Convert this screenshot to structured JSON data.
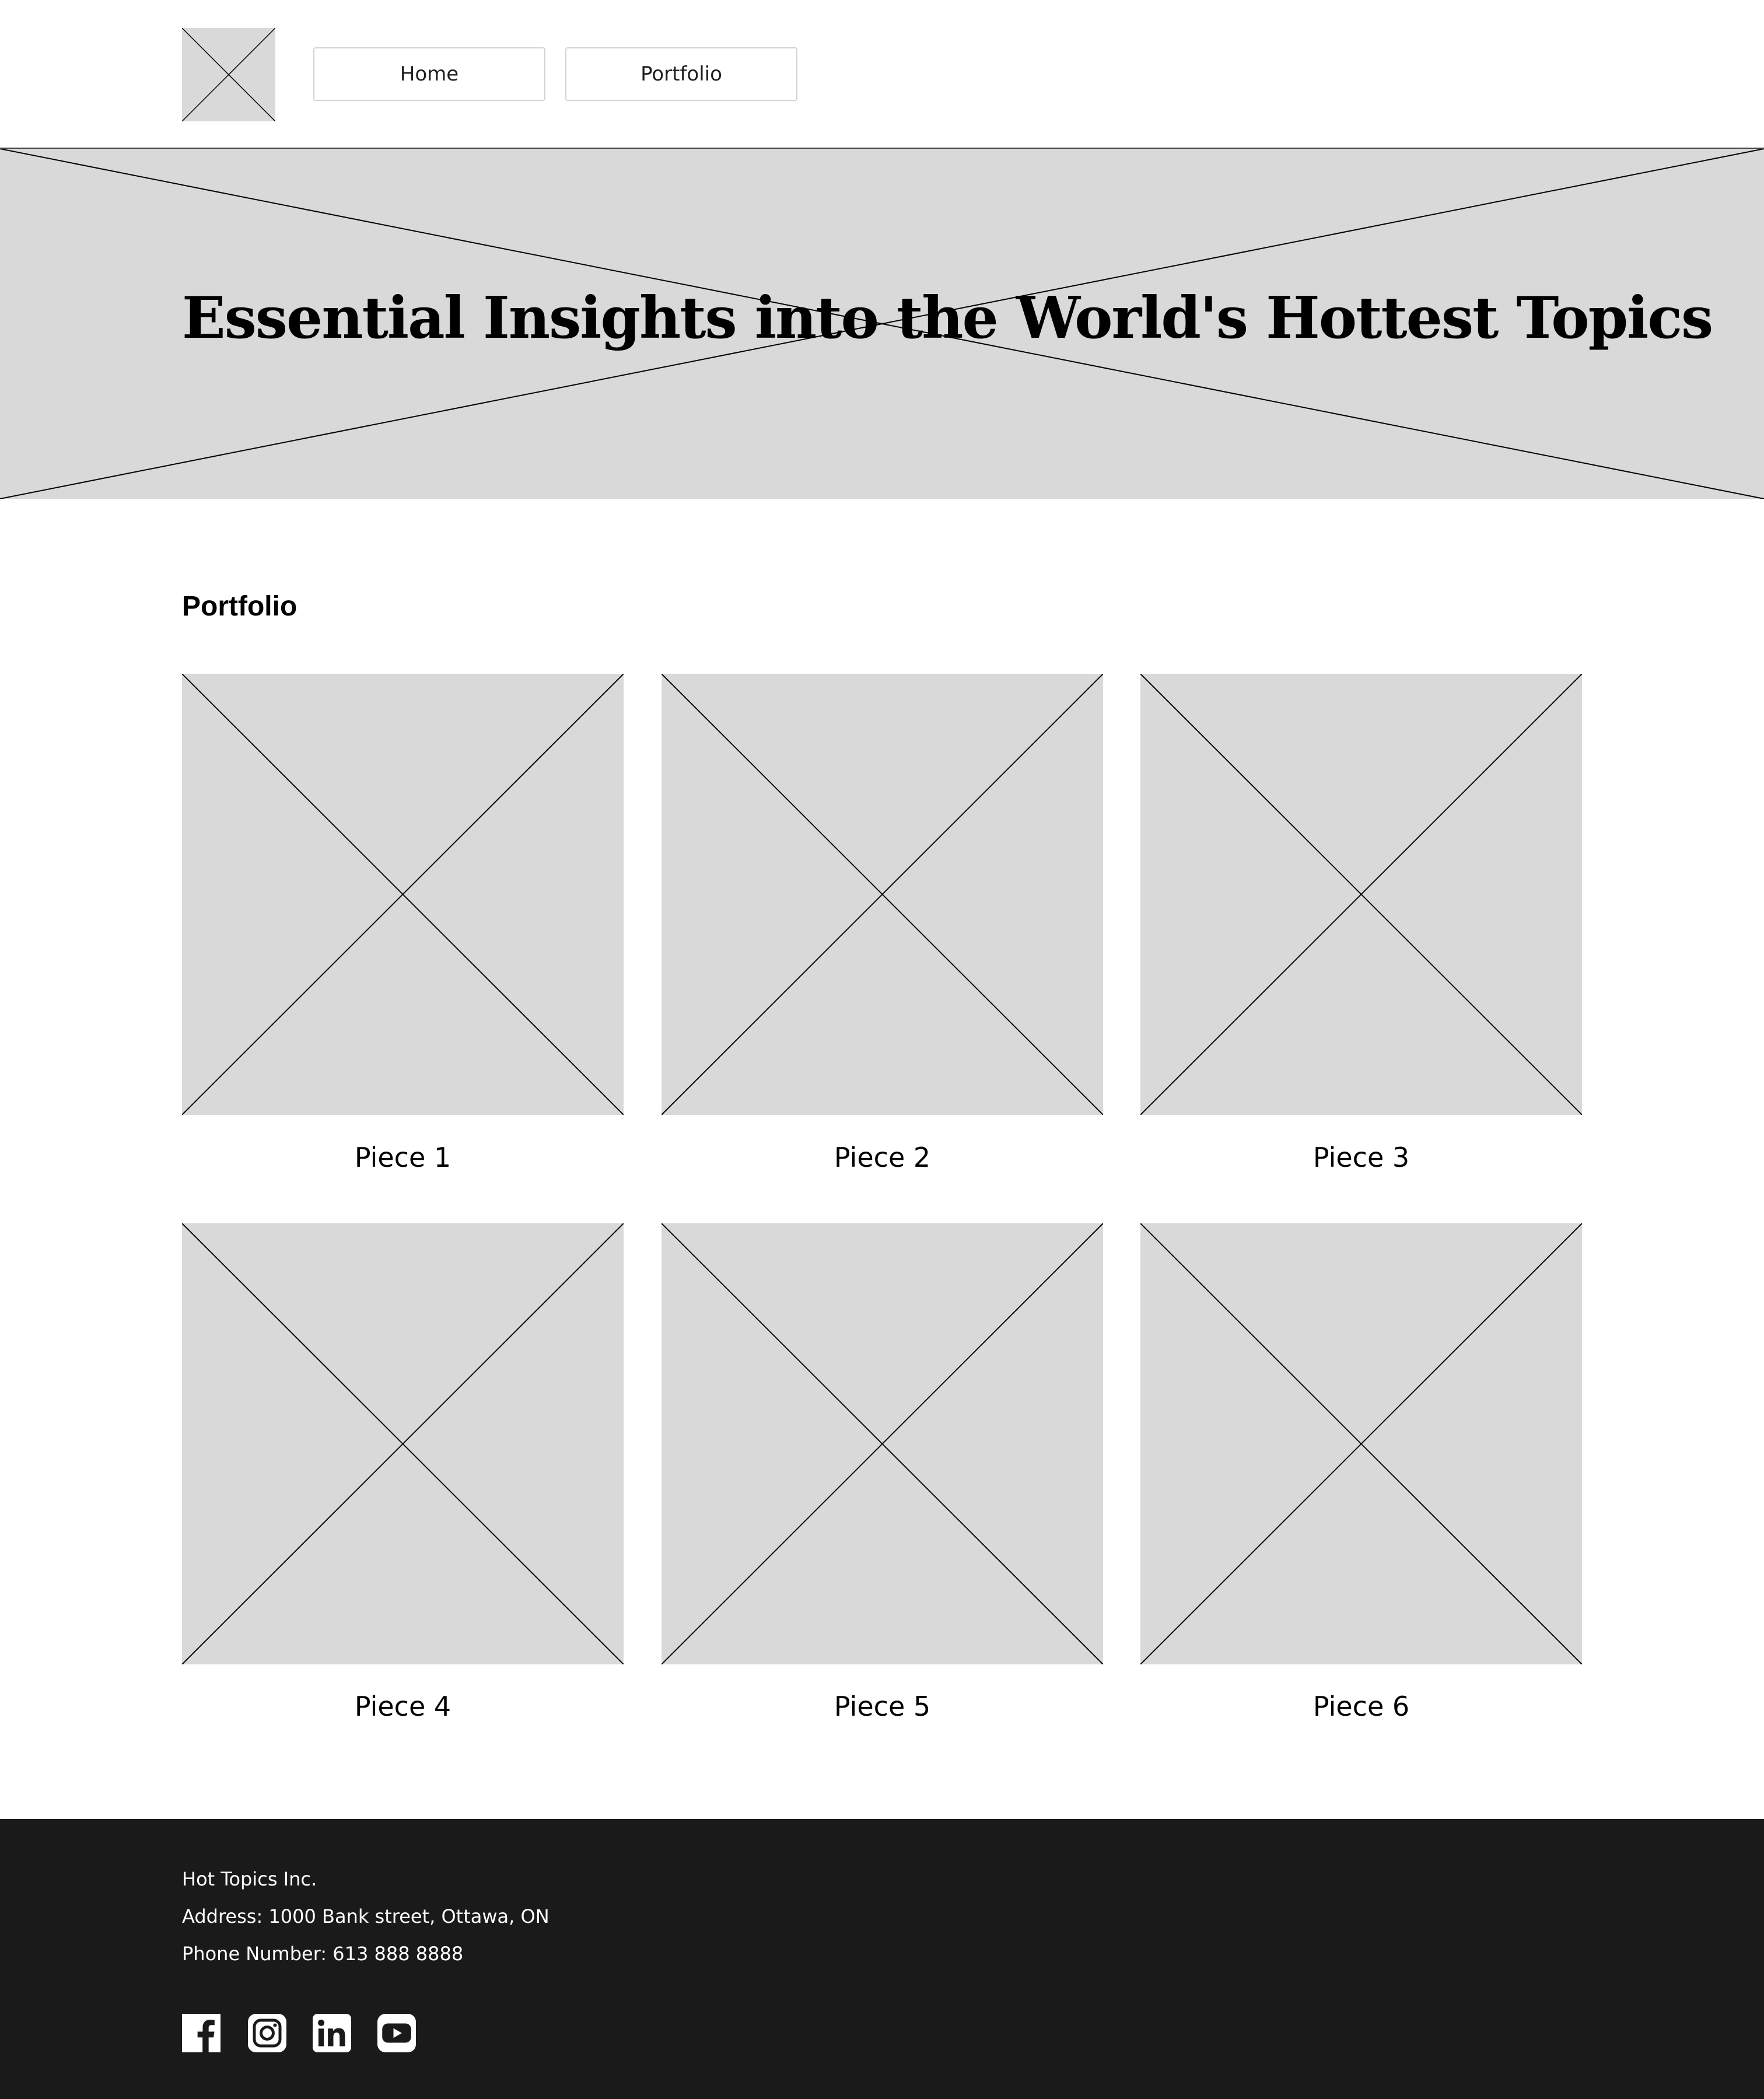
{
  "header": {
    "logo_icon": "image-placeholder-icon",
    "nav": [
      {
        "label": "Home"
      },
      {
        "label": "Portfolio"
      }
    ]
  },
  "hero": {
    "title": "Essential Insights into the World's Hottest Topics",
    "background_icon": "image-placeholder-icon"
  },
  "portfolio": {
    "heading": "Portfolio",
    "items": [
      {
        "caption": "Piece 1",
        "image_icon": "image-placeholder-icon"
      },
      {
        "caption": "Piece 2",
        "image_icon": "image-placeholder-icon"
      },
      {
        "caption": "Piece 3",
        "image_icon": "image-placeholder-icon"
      },
      {
        "caption": "Piece 4",
        "image_icon": "image-placeholder-icon"
      },
      {
        "caption": "Piece 5",
        "image_icon": "image-placeholder-icon"
      },
      {
        "caption": "Piece 6",
        "image_icon": "image-placeholder-icon"
      }
    ]
  },
  "footer": {
    "company": "Hot Topics Inc.",
    "address": "Address: 1000 Bank street, Ottawa, ON",
    "phone": "Phone Number: 613 888 8888",
    "social": [
      {
        "icon": "facebook-icon"
      },
      {
        "icon": "instagram-icon"
      },
      {
        "icon": "linkedin-icon"
      },
      {
        "icon": "youtube-icon"
      }
    ]
  },
  "colors": {
    "placeholder_bg": "#d9d9d9",
    "footer_bg": "#1a1a1a",
    "text": "#000000",
    "footer_text": "#ffffff"
  }
}
